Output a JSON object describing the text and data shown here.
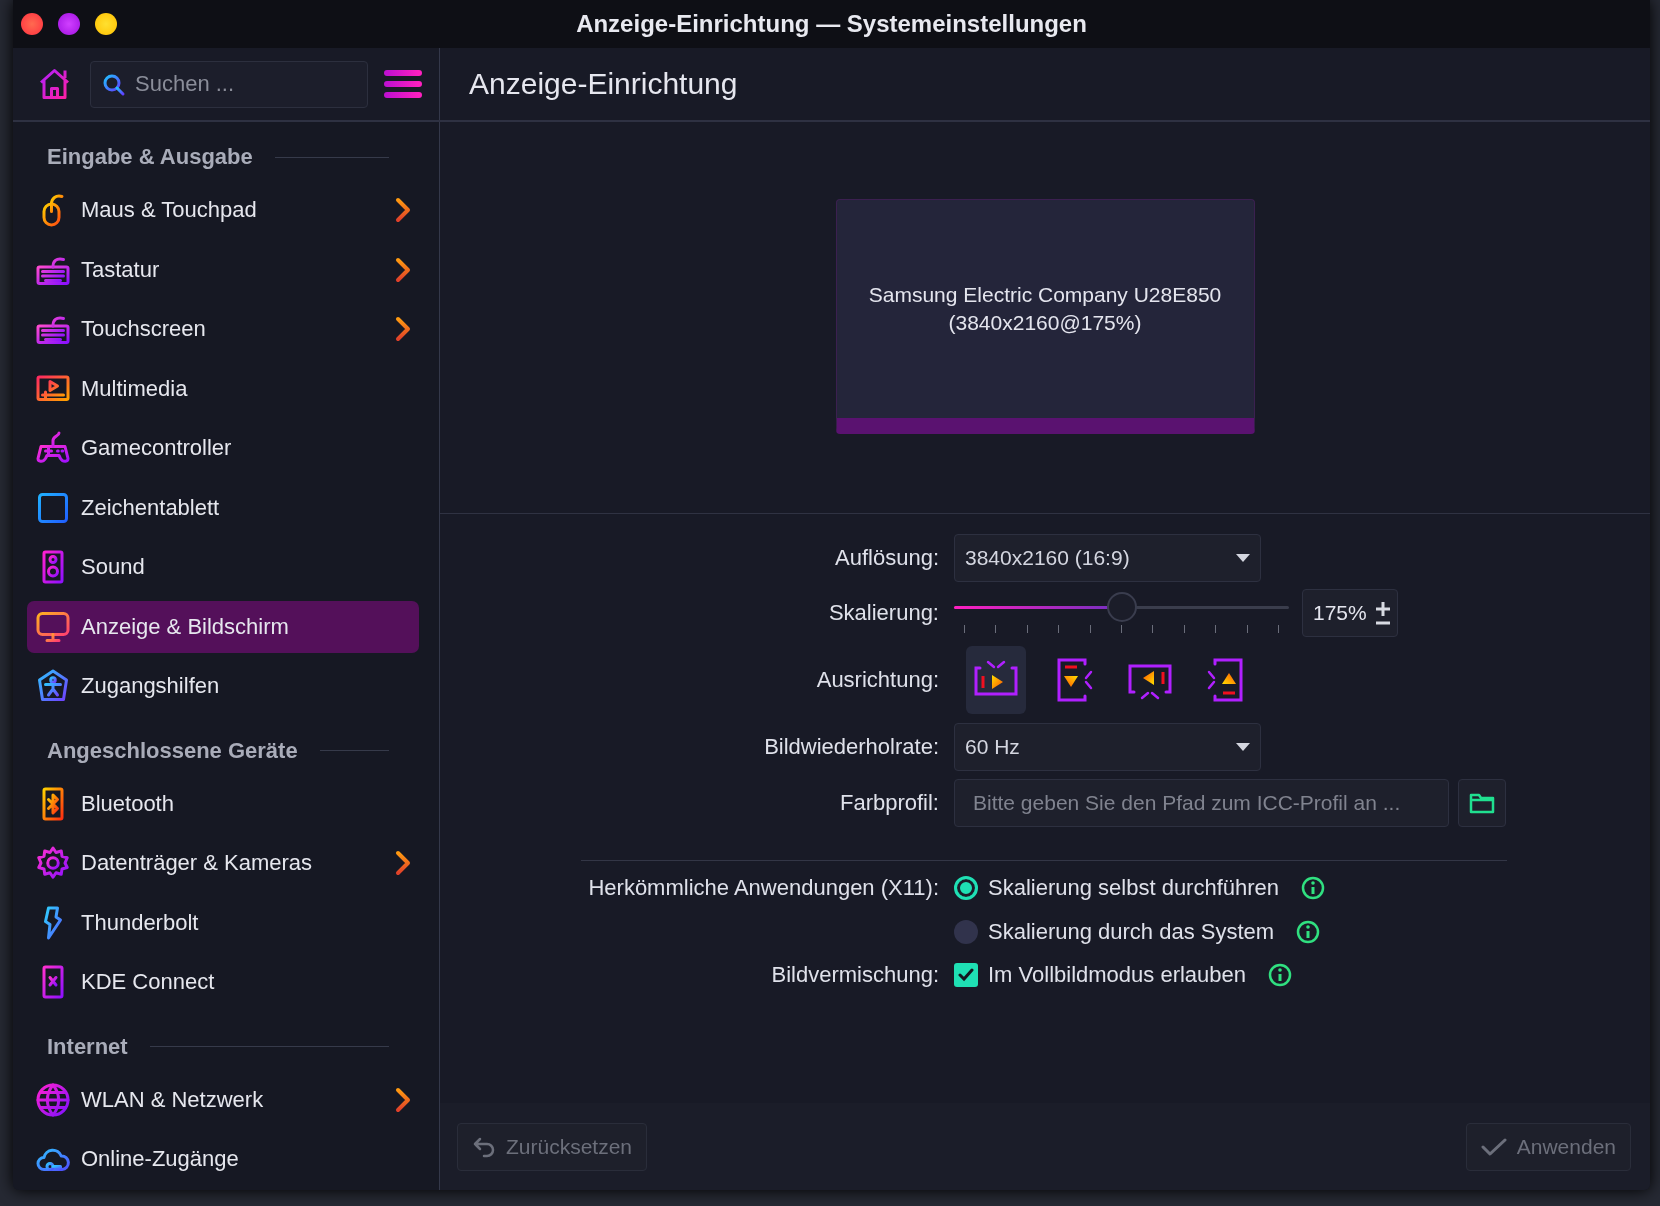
{
  "window": {
    "title": "Anzeige-Einrichtung — Systemeinstellungen"
  },
  "toolbar": {
    "search": {
      "placeholder": "Suchen ..."
    }
  },
  "sidebar": {
    "sections": [
      {
        "title": "Eingabe & Ausgabe",
        "items": [
          {
            "label": "Maus & Touchpad",
            "kind": "mouse",
            "has_submenu": true,
            "selected": false
          },
          {
            "label": "Tastatur",
            "kind": "keyboard",
            "has_submenu": true,
            "selected": false
          },
          {
            "label": "Touchscreen",
            "kind": "keyboard",
            "has_submenu": true,
            "selected": false
          },
          {
            "label": "Multimedia",
            "kind": "media",
            "has_submenu": false,
            "selected": false
          },
          {
            "label": "Gamecontroller",
            "kind": "gamepad",
            "has_submenu": false,
            "selected": false
          },
          {
            "label": "Zeichentablett",
            "kind": "tablet",
            "has_submenu": false,
            "selected": false
          },
          {
            "label": "Sound",
            "kind": "speaker",
            "has_submenu": false,
            "selected": false
          },
          {
            "label": "Anzeige & Bildschirm",
            "kind": "display",
            "has_submenu": false,
            "selected": true
          },
          {
            "label": "Zugangshilfen",
            "kind": "accessibility",
            "has_submenu": false,
            "selected": false
          }
        ]
      },
      {
        "title": "Angeschlossene Geräte",
        "items": [
          {
            "label": "Bluetooth",
            "kind": "bluetooth",
            "has_submenu": false,
            "selected": false
          },
          {
            "label": "Datenträger & Kameras",
            "kind": "gear",
            "has_submenu": true,
            "selected": false
          },
          {
            "label": "Thunderbolt",
            "kind": "bolt",
            "has_submenu": false,
            "selected": false
          },
          {
            "label": "KDE Connect",
            "kind": "phone",
            "has_submenu": false,
            "selected": false
          }
        ]
      },
      {
        "title": "Internet",
        "items": [
          {
            "label": "WLAN & Netzwerk",
            "kind": "globe",
            "has_submenu": true,
            "selected": false
          },
          {
            "label": "Online-Zugänge",
            "kind": "cloud",
            "has_submenu": false,
            "selected": false
          }
        ]
      }
    ]
  },
  "page": {
    "title": "Anzeige-Einrichtung",
    "monitor": {
      "name": "Samsung Electric Company U28E850",
      "mode": "(3840x2160@175%)"
    },
    "resolution": {
      "label": "Auflösung:",
      "value": "3840x2160 (16:9)"
    },
    "scaling": {
      "label": "Skalierung:",
      "level": 0.5,
      "reading": "175%"
    },
    "orientation": {
      "label": "Ausrichtung:",
      "options": [
        {
          "kind": "landscape",
          "selected": true
        },
        {
          "kind": "portrait",
          "selected": false
        },
        {
          "kind": "landscape-flipped",
          "selected": false
        },
        {
          "kind": "portrait-flipped",
          "selected": false
        }
      ]
    },
    "refresh_rate": {
      "label": "Bildwiederholrate:",
      "value": "60 Hz"
    },
    "color_profile": {
      "label": "Farbprofil:",
      "placeholder": "Bitte geben Sie den Pfad zum ICC-Profil an ..."
    },
    "legacy_apps": {
      "label": "Herkömmliche Anwendungen (X11):",
      "options": [
        {
          "label": "Skalierung selbst durchführen",
          "selected": true
        },
        {
          "label": "Skalierung durch das System",
          "selected": false
        }
      ]
    },
    "blending": {
      "label": "Bildvermischung:",
      "option": {
        "label": "Im Vollbildmodus erlauben",
        "checked": true
      }
    },
    "footer": {
      "reset": {
        "label": "Zurücksetzen",
        "disabled": true
      },
      "apply": {
        "label": "Anwenden",
        "disabled": true
      }
    }
  }
}
